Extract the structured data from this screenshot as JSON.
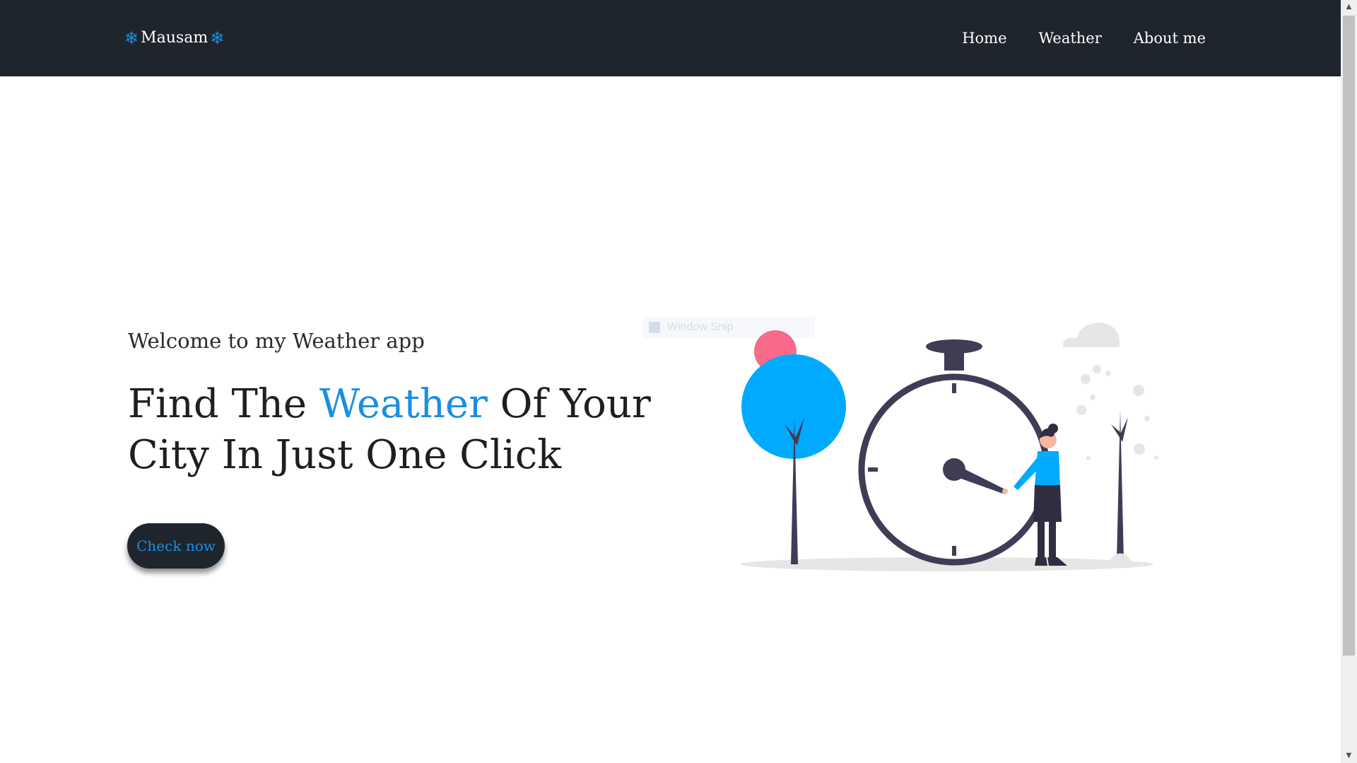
{
  "navbar": {
    "brand": "Mausam",
    "brand_icon": "snowflake-icon",
    "links": [
      "Home",
      "Weather",
      "About me"
    ]
  },
  "hero": {
    "subtitle": "Welcome to my Weather app",
    "headline_pre": "Find The ",
    "headline_accent": "Weather",
    "headline_post": " Of Your City In Just One Click",
    "cta_label": "Check now"
  },
  "ghost_overlay": {
    "label": "Window Snip"
  },
  "colors": {
    "navbar_bg": "#1f252d",
    "accent": "#1a8fe0",
    "illustration_blue": "#00aaff",
    "illustration_pink": "#f86a8a",
    "illustration_dark": "#3f3d56"
  }
}
